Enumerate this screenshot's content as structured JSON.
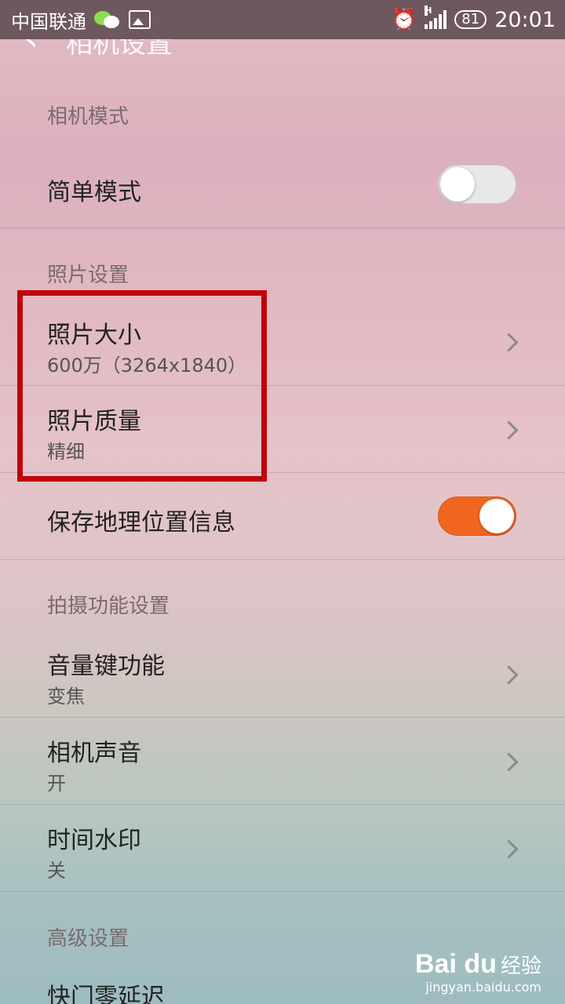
{
  "status_bar": {
    "carrier": "中国联通",
    "network": "H",
    "battery": "81",
    "time": "20:01"
  },
  "header": {
    "title": "相机设置"
  },
  "sections": {
    "camera_mode": "相机模式",
    "photo_settings": "照片设置",
    "shooting": "拍摄功能设置",
    "advanced": "高级设置"
  },
  "rows": {
    "simple_mode": {
      "title": "简单模式",
      "toggle_on": false
    },
    "photo_size": {
      "title": "照片大小",
      "value": "600万（3264x1840）"
    },
    "photo_quality": {
      "title": "照片质量",
      "value": "精细"
    },
    "save_location": {
      "title": "保存地理位置信息",
      "toggle_on": true
    },
    "volume_key": {
      "title": "音量键功能",
      "value": "变焦"
    },
    "camera_sound": {
      "title": "相机声音",
      "value": "开"
    },
    "time_watermark": {
      "title": "时间水印",
      "value": "关"
    },
    "shutter_zero_lag": {
      "title": "快门零延迟"
    }
  },
  "highlight_color": "#c1000a",
  "accent_color": "#f0661e",
  "watermark": {
    "logo": "Bai du",
    "text": "经验",
    "url": "jingyan.baidu.com"
  }
}
